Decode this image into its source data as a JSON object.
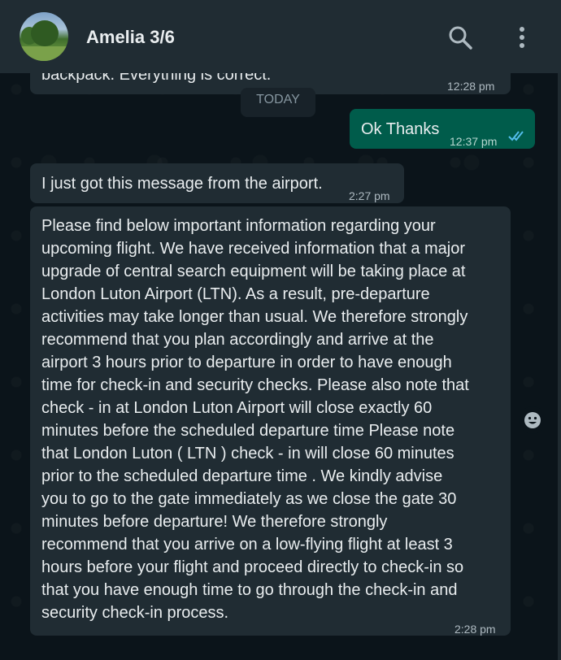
{
  "header": {
    "contact_name": "Amelia 3/6",
    "avatar_icon": "avatar-photo",
    "search_icon": "search-icon",
    "menu_icon": "more-vertical-icon"
  },
  "colors": {
    "header_bg": "#202c33",
    "chat_bg": "#0b141a",
    "incoming_bubble": "#202c33",
    "outgoing_bubble": "#005c4b",
    "read_ticks": "#53bdeb"
  },
  "messages": [
    {
      "direction": "in",
      "text": "backpack. Everything is correct.",
      "time": "12:28 pm"
    },
    {
      "type": "date",
      "text": "TODAY"
    },
    {
      "direction": "out",
      "text": "Ok Thanks",
      "time": "12:37 pm",
      "status": "read"
    },
    {
      "direction": "in",
      "text": "I just got this message from the airport.",
      "time": "2:27 pm"
    },
    {
      "direction": "in",
      "lines": [
        "Please find below important information regarding your",
        "upcoming flight.  We have received information that a major",
        "upgrade of central search equipment will be taking place at",
        "London Luton Airport (LTN).  As a result, pre-departure",
        "activities may take longer than usual.  We therefore strongly",
        "recommend that you plan accordingly and arrive at the",
        "airport 3 hours prior to departure in order to have enough",
        "time for check-in and security checks.  Please also note that",
        "check - in at London Luton Airport will close exactly 60",
        "minutes before the scheduled departure time Please note",
        "that London Luton ( LTN ) check - in will close 60 minutes",
        "prior to the scheduled departure time .  We kindly advise",
        "you to go to the gate immediately as we close the gate 30",
        "minutes before departure!  We therefore strongly",
        "recommend that you arrive on a low-flying flight at least 3",
        "hours before your flight and proceed directly to check-in so",
        "that you have enough time to go through the check-in and",
        "security check-in process."
      ],
      "time": "2:28 pm"
    }
  ],
  "emoji_button_icon": "emoji-icon"
}
